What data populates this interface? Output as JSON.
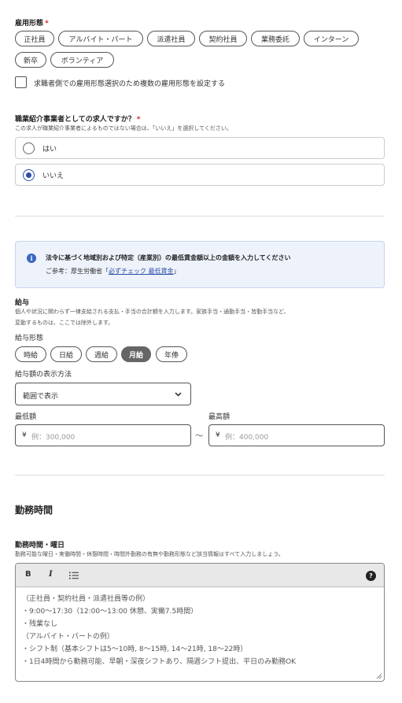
{
  "employment": {
    "label": "雇用形態",
    "required_mark": "*",
    "options": [
      "正社員",
      "アルバイト・パート",
      "派遣社員",
      "契約社員",
      "業務委託",
      "インターン",
      "新卒",
      "ボランティア"
    ],
    "multi_checkbox_label": "求職者側での雇用形態選択のため複数の雇用形態を設定する"
  },
  "agency": {
    "label": "職業紹介事業者としての求人ですか？",
    "required_mark": "*",
    "help": "この求人が職業紹介事業者によるものではない場合は、「いいえ」を選択してください。",
    "options": [
      "はい",
      "いいえ"
    ],
    "selected": "いいえ"
  },
  "notice": {
    "icon": "info-icon",
    "title": "法令に基づく地域別および特定（産業別）の最低賃金額以上の金額を入力してください",
    "ref_prefix": "ご参考：厚生労働省「",
    "ref_link": "必ずチェック 最低賃金",
    "ref_suffix": "」"
  },
  "salary": {
    "title": "給与",
    "desc_line1": "個人や状況に関わらず一律支給される支払・手当の合計額を入力します。家族手当・通勤手当・皆勤手当など、",
    "desc_line2": "変動するものは、ここでは除外します。",
    "type_label": "給与形態",
    "types": [
      "時給",
      "日給",
      "週給",
      "月給",
      "年俸"
    ],
    "selected_type": "月給",
    "display_label": "給与額の表示方法",
    "display_value": "範囲で表示",
    "min_label": "最低額",
    "max_label": "最高額",
    "currency": "¥",
    "min_placeholder": "例：300,000",
    "max_placeholder": "例：400,000",
    "range_sep": "〜"
  },
  "hours": {
    "section_title": "勤務時間",
    "field_label": "勤務時間・曜日",
    "help": "勤務可能な曜日・実働時間・休憩時間・時間外勤務の有無や勤務形態など該当情報はすべて入力しましょう。",
    "toolbar": {
      "bold": "B",
      "italic": "I",
      "help": "?"
    },
    "placeholder_lines": [
      "（正社員・契約社員・派遣社員等の例）",
      "・9:00〜17:30（12:00〜13:00 休憩、実働7.5時間）",
      "・残業なし",
      "（アルバイト・パートの例）",
      "・シフト制（基本シフトは5〜10時, 8〜15時, 14〜21時, 18〜22時）",
      "・1日4時間から勤務可能、早朝・深夜シフトあり、隔週シフト提出、平日のみ勤務OK"
    ]
  }
}
